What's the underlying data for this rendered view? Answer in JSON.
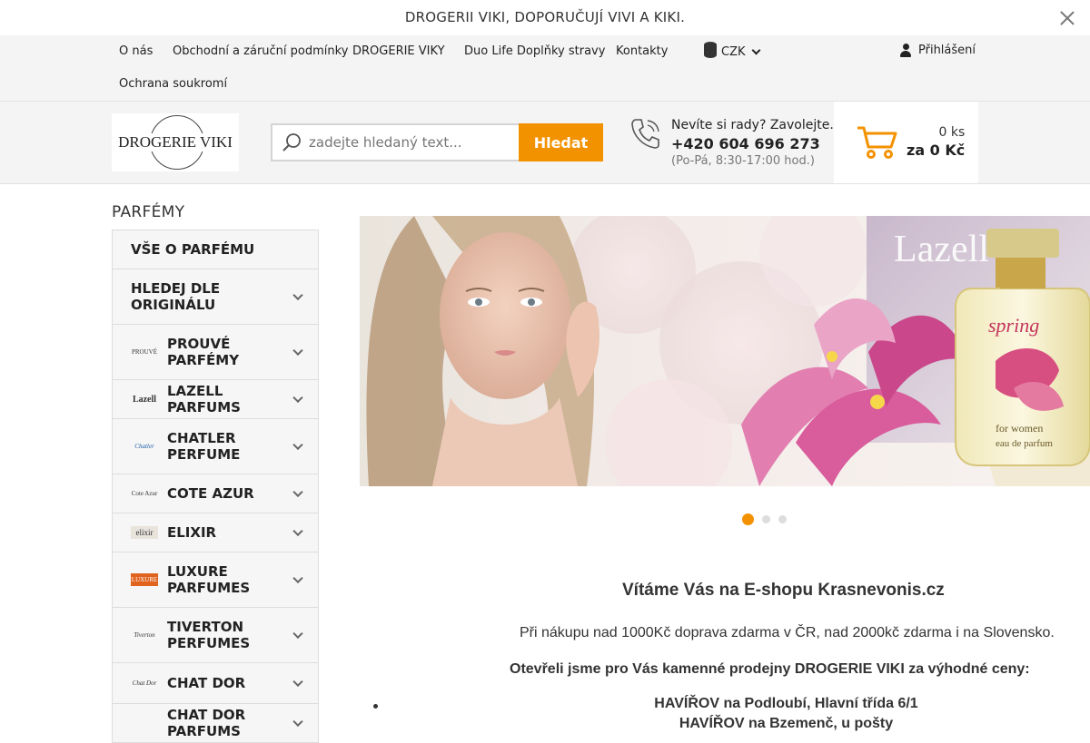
{
  "announcement": {
    "text": "DROGERII VIKI, DOPORUČUJÍ VIVI A KIKI."
  },
  "topnav": {
    "links": [
      "O nás",
      "Obchodní a záruční podmínky",
      "DROGERIE VIKY",
      "Duo Life Doplňky stravy",
      "Kontakty",
      "Ochrana soukromí"
    ],
    "currency": "CZK",
    "login": "Přihlášení"
  },
  "header": {
    "logo_text": "DROGERIE VIKI",
    "search_placeholder": "zadejte hledaný text...",
    "search_button": "Hledat",
    "phone_question": "Nevíte si rady? Zavolejte.",
    "phone_number": "+420 604 696 273",
    "phone_hours": "(Po-Pá, 8:30-17:00 hod.)",
    "cart_count": "0 ks",
    "cart_total": "za 0 Kč"
  },
  "sidebar": {
    "title": "PARFÉMY",
    "items": [
      {
        "label": "VŠE O PARFÉMU",
        "thumb": "",
        "arrow": false
      },
      {
        "label": "HLEDEJ DLE ORIGINÁLU",
        "thumb": "",
        "arrow": true
      },
      {
        "label": "PROUVÉ PARFÉMY",
        "thumb": "PROUVÉ",
        "arrow": true
      },
      {
        "label": "LAZELL PARFUMS",
        "thumb": "Lazell",
        "arrow": true
      },
      {
        "label": "CHATLER PERFUME",
        "thumb": "Chatler",
        "arrow": true
      },
      {
        "label": "COTE AZUR",
        "thumb": "Cote Azur",
        "arrow": true
      },
      {
        "label": "ELIXIR",
        "thumb": "elixir",
        "arrow": true
      },
      {
        "label": "LUXURE PARFUMES",
        "thumb": "LUXURE",
        "arrow": true
      },
      {
        "label": "TIVERTON PERFUMES",
        "thumb": "Tiverton",
        "arrow": true
      },
      {
        "label": "CHAT DOR",
        "thumb": "Chat Dor",
        "arrow": true
      },
      {
        "label": "CHAT DOR PARFUMS",
        "thumb": "",
        "arrow": true
      }
    ]
  },
  "banner": {
    "product_brand": "Lazell",
    "product_name": "spring",
    "product_sub": "for women",
    "product_type": "eau de parfum",
    "slides": 3,
    "active_slide": 1
  },
  "content": {
    "heading": "Vítáme Vás na E-shopu Krasnevonis.cz",
    "shipping": "Při nákupu nad 1000Kč doprava zdarma v ČR, nad 2000kč zdarma i na Slovensko.",
    "stores_intro": "Otevřeli jsme pro Vás kamenné prodejny DROGERIE VIKI za výhodné ceny:",
    "stores": [
      "HAVÍŘOV na Podloubí, Hlavní třída 6/1",
      "HAVÍŘOV na Bzemenč, u pošty"
    ]
  },
  "colors": {
    "accent": "#f39200",
    "nav_bg": "#f4f4f4"
  }
}
